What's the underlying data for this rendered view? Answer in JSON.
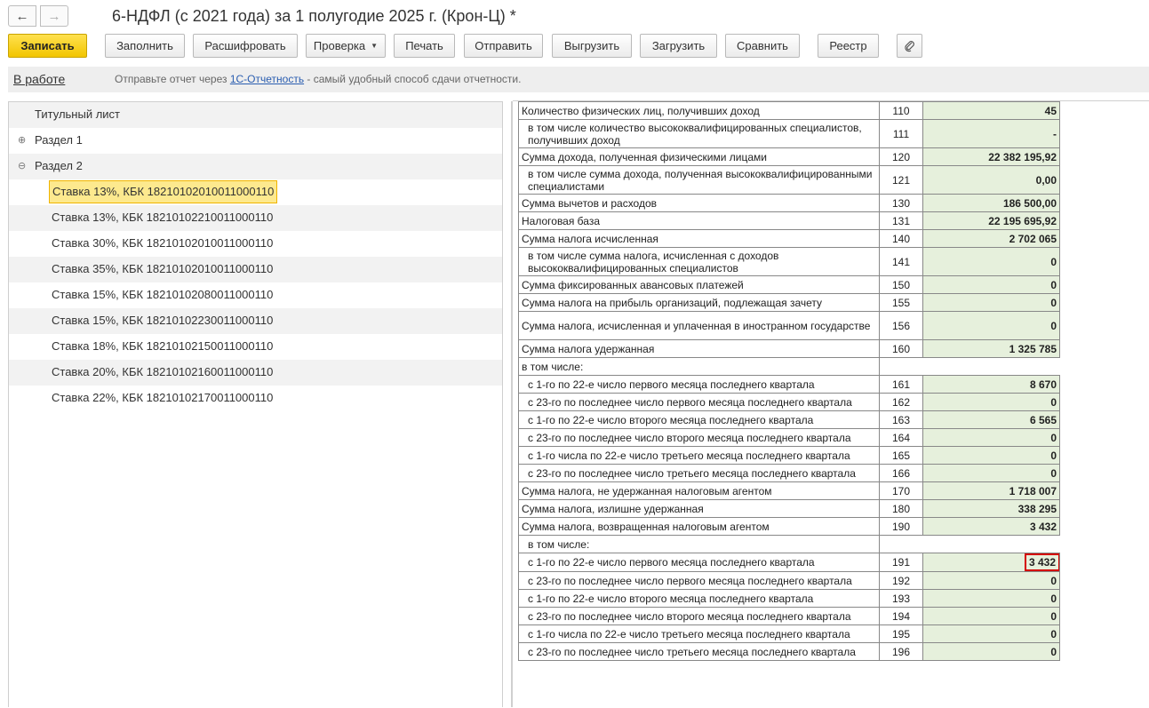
{
  "window": {
    "title": "6-НДФЛ (с 2021 года) за 1 полугодие 2025 г. (Крон-Ц) *",
    "back_icon": "←",
    "forward_icon": "→"
  },
  "toolbar": {
    "save": "Записать",
    "fill": "Заполнить",
    "decode": "Расшифровать",
    "check": "Проверка",
    "print": "Печать",
    "send": "Отправить",
    "export": "Выгрузить",
    "import": "Загрузить",
    "compare": "Сравнить",
    "registry": "Реестр"
  },
  "infobar": {
    "status": "В работе",
    "text_before": "Отправьте отчет через ",
    "link": "1С-Отчетность",
    "text_after": " - самый удобный способ сдачи отчетности."
  },
  "tree": {
    "title_page": "Титульный лист",
    "section1": "Раздел 1",
    "section2": "Раздел 2",
    "expand_icon": "⊕",
    "collapse_icon": "⊖",
    "rates": [
      "Ставка 13%, КБК 18210102010011000110",
      "Ставка 13%, КБК 18210102210011000110",
      "Ставка 30%, КБК 18210102010011000110",
      "Ставка 35%, КБК 18210102010011000110",
      "Ставка 15%, КБК 18210102080011000110",
      "Ставка 15%, КБК 18210102230011000110",
      "Ставка 18%, КБК 18210102150011000110",
      "Ставка 20%, КБК 18210102160011000110",
      "Ставка 22%, КБК 18210102170011000110"
    ]
  },
  "report": {
    "rows": [
      {
        "desc": "Количество физических лиц, получивших доход",
        "code": "110",
        "value": "45"
      },
      {
        "desc": "в том числе количество высококвалифицированных специалистов, получивших доход",
        "code": "111",
        "value": "-"
      },
      {
        "desc": "Сумма дохода, полученная физическими лицами",
        "code": "120",
        "value": "22 382 195,92"
      },
      {
        "desc": "в том числе сумма дохода, полученная высококвалифицированными специалистами",
        "code": "121",
        "value": "0,00"
      },
      {
        "desc": "Сумма вычетов и расходов",
        "code": "130",
        "value": "186 500,00"
      },
      {
        "desc": "Налоговая база",
        "code": "131",
        "value": "22 195 695,92"
      },
      {
        "desc": "Сумма налога исчисленная",
        "code": "140",
        "value": "2 702 065"
      },
      {
        "desc": "в том числе сумма налога, исчисленная с доходов высококвалифицированных специалистов",
        "code": "141",
        "value": "0"
      },
      {
        "desc": "Сумма фиксированных авансовых платежей",
        "code": "150",
        "value": "0"
      },
      {
        "desc": "Сумма налога на прибыль организаций, подлежащая зачету",
        "code": "155",
        "value": "0"
      },
      {
        "desc": "Сумма налога, исчисленная и уплаченная в иностранном государстве",
        "code": "156",
        "value": "0"
      },
      {
        "desc": "Сумма налога удержанная",
        "code": "160",
        "value": "1 325 785"
      },
      {
        "desc": "в том числе:",
        "code": "",
        "value": ""
      },
      {
        "desc": "с 1-го по 22-е число первого месяца последнего квартала",
        "code": "161",
        "value": "8 670"
      },
      {
        "desc": "с 23-го по последнее число первого месяца последнего квартала",
        "code": "162",
        "value": "0"
      },
      {
        "desc": "с 1-го по 22-е число второго месяца последнего квартала",
        "code": "163",
        "value": "6 565"
      },
      {
        "desc": "с 23-го по последнее число второго месяца последнего квартала",
        "code": "164",
        "value": "0"
      },
      {
        "desc": "с 1-го числа по 22-е число третьего месяца последнего квартала",
        "code": "165",
        "value": "0"
      },
      {
        "desc": "с 23-го по последнее число третьего месяца последнего квартала",
        "code": "166",
        "value": "0"
      },
      {
        "desc": "Сумма налога, не удержанная налоговым агентом",
        "code": "170",
        "value": "1 718 007"
      },
      {
        "desc": "Сумма налога, излишне удержанная",
        "code": "180",
        "value": "338 295"
      },
      {
        "desc": "Сумма налога, возвращенная налоговым агентом",
        "code": "190",
        "value": "3 432"
      },
      {
        "desc": "в том числе:",
        "code": "",
        "value": ""
      },
      {
        "desc": "с 1-го по 22-е число первого месяца последнего квартала",
        "code": "191",
        "value": "3 432"
      },
      {
        "desc": "с 23-го по последнее число первого месяца последнего квартала",
        "code": "192",
        "value": "0"
      },
      {
        "desc": "с 1-го по 22-е число второго месяца последнего квартала",
        "code": "193",
        "value": "0"
      },
      {
        "desc": "с 23-го по последнее число второго месяца последнего квартала",
        "code": "194",
        "value": "0"
      },
      {
        "desc": "с 1-го числа по 22-е число третьего месяца последнего квартала",
        "code": "195",
        "value": "0"
      },
      {
        "desc": "с 23-го по последнее число третьего месяца последнего квартала",
        "code": "196",
        "value": "0"
      }
    ]
  }
}
